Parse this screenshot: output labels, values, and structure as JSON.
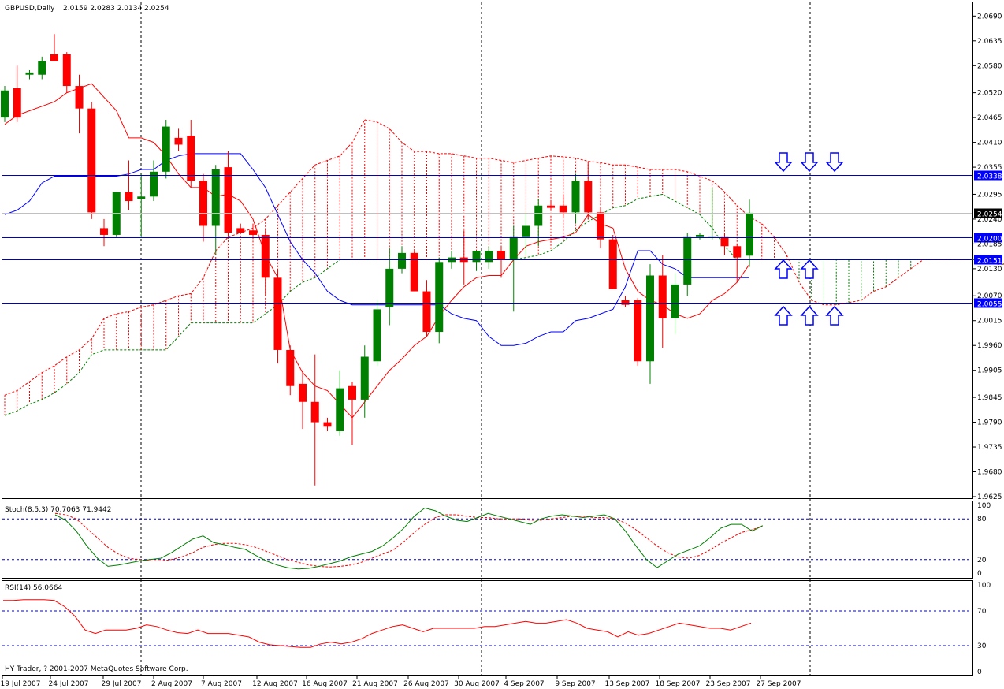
{
  "header": {
    "symbol": "GBPUSD,Daily",
    "ohlc": "2.0159 2.0283 2.0134 2.0254"
  },
  "footer": {
    "copyright": "HY Trader, ? 2001-2007 MetaQuotes Software Corp."
  },
  "colors": {
    "bull": "#008000",
    "bear": "#ff0000",
    "tenkan": "#ff0000",
    "kijun": "#0000ff",
    "span_a": "#ff0000",
    "span_b": "#008000",
    "level_line": "#0000c0",
    "price_tag_bg": "#0000ff",
    "close_tag_bg": "#000000",
    "arrow": "#0000ff"
  },
  "chart_data": [
    {
      "type": "candlestick",
      "title": "GBPUSD,Daily",
      "ylim": [
        1.9625,
        2.0715
      ],
      "y_ticks": [
        "2.0690",
        "2.0635",
        "2.0580",
        "2.0520",
        "2.0465",
        "2.0410",
        "2.0355",
        "2.0295",
        "2.0240",
        "2.0185",
        "2.0130",
        "2.0070",
        "2.0015",
        "1.9960",
        "1.9905",
        "1.9845",
        "1.9790",
        "1.9735",
        "1.9680",
        "1.9625"
      ],
      "x_tick_labels": [
        "19 Jul 2007",
        "24 Jul 2007",
        "29 Jul 2007",
        "2 Aug 2007",
        "7 Aug 2007",
        "12 Aug 2007",
        "16 Aug 2007",
        "21 Aug 2007",
        "26 Aug 2007",
        "30 Aug 2007",
        "4 Sep 2007",
        "9 Sep 2007",
        "13 Sep 2007",
        "18 Sep 2007",
        "23 Sep 2007",
        "27 Sep 2007"
      ],
      "candles": [
        {
          "o": 2.0465,
          "h": 2.0535,
          "l": 2.0455,
          "c": 2.0525
        },
        {
          "o": 2.053,
          "h": 2.058,
          "l": 2.0455,
          "c": 2.0465
        },
        {
          "o": 2.056,
          "h": 2.057,
          "l": 2.055,
          "c": 2.0565
        },
        {
          "o": 2.056,
          "h": 2.06,
          "l": 2.055,
          "c": 2.059
        },
        {
          "o": 2.0605,
          "h": 2.065,
          "l": 2.059,
          "c": 2.059
        },
        {
          "o": 2.0605,
          "h": 2.061,
          "l": 2.052,
          "c": 2.0535
        },
        {
          "o": 2.0535,
          "h": 2.056,
          "l": 2.043,
          "c": 2.0485
        },
        {
          "o": 2.0485,
          "h": 2.05,
          "l": 2.024,
          "c": 2.0255
        },
        {
          "o": 2.022,
          "h": 2.024,
          "l": 2.018,
          "c": 2.0205
        },
        {
          "o": 2.0205,
          "h": 2.03,
          "l": 2.02,
          "c": 2.03
        },
        {
          "o": 2.03,
          "h": 2.037,
          "l": 2.026,
          "c": 2.028
        },
        {
          "o": 2.0285,
          "h": 2.034,
          "l": 2.02,
          "c": 2.029
        },
        {
          "o": 2.029,
          "h": 2.037,
          "l": 2.028,
          "c": 2.0345
        },
        {
          "o": 2.0345,
          "h": 2.046,
          "l": 2.033,
          "c": 2.0445
        },
        {
          "o": 2.042,
          "h": 2.044,
          "l": 2.039,
          "c": 2.0405
        },
        {
          "o": 2.0425,
          "h": 2.046,
          "l": 2.031,
          "c": 2.0325
        },
        {
          "o": 2.0325,
          "h": 2.034,
          "l": 2.019,
          "c": 2.0225
        },
        {
          "o": 2.0225,
          "h": 2.036,
          "l": 2.016,
          "c": 2.035
        },
        {
          "o": 2.0355,
          "h": 2.039,
          "l": 2.02,
          "c": 2.021
        },
        {
          "o": 2.022,
          "h": 2.023,
          "l": 2.021,
          "c": 2.021
        },
        {
          "o": 2.0215,
          "h": 2.023,
          "l": 2.02,
          "c": 2.0205
        },
        {
          "o": 2.0205,
          "h": 2.022,
          "l": 2.007,
          "c": 2.011
        },
        {
          "o": 2.011,
          "h": 2.013,
          "l": 1.992,
          "c": 1.995
        },
        {
          "o": 1.995,
          "h": 1.996,
          "l": 1.985,
          "c": 1.987
        },
        {
          "o": 1.9875,
          "h": 1.9905,
          "l": 1.9775,
          "c": 1.9835
        },
        {
          "o": 1.9835,
          "h": 1.994,
          "l": 1.965,
          "c": 1.979
        },
        {
          "o": 1.979,
          "h": 1.98,
          "l": 1.977,
          "c": 1.978
        },
        {
          "o": 1.977,
          "h": 1.9905,
          "l": 1.976,
          "c": 1.9865
        },
        {
          "o": 1.987,
          "h": 1.988,
          "l": 1.974,
          "c": 1.984
        },
        {
          "o": 1.984,
          "h": 1.996,
          "l": 1.98,
          "c": 1.9935
        },
        {
          "o": 1.9925,
          "h": 2.006,
          "l": 1.9915,
          "c": 2.004
        },
        {
          "o": 2.0045,
          "h": 2.0175,
          "l": 2.0005,
          "c": 2.013
        },
        {
          "o": 2.013,
          "h": 2.018,
          "l": 2.012,
          "c": 2.0165
        },
        {
          "o": 2.0165,
          "h": 2.017,
          "l": 2.008,
          "c": 2.008
        },
        {
          "o": 2.008,
          "h": 2.0105,
          "l": 1.998,
          "c": 1.999
        },
        {
          "o": 1.999,
          "h": 2.0155,
          "l": 1.9965,
          "c": 2.0145
        },
        {
          "o": 2.0145,
          "h": 2.017,
          "l": 2.013,
          "c": 2.0155
        },
        {
          "o": 2.0155,
          "h": 2.0215,
          "l": 2.0095,
          "c": 2.0145
        },
        {
          "o": 2.0145,
          "h": 2.0165,
          "l": 2.0125,
          "c": 2.017
        },
        {
          "o": 2.0145,
          "h": 2.018,
          "l": 2.013,
          "c": 2.017
        },
        {
          "o": 2.017,
          "h": 2.018,
          "l": 2.011,
          "c": 2.015
        },
        {
          "o": 2.015,
          "h": 2.0225,
          "l": 2.0035,
          "c": 2.02
        },
        {
          "o": 2.02,
          "h": 2.0255,
          "l": 2.016,
          "c": 2.0225
        },
        {
          "o": 2.0225,
          "h": 2.0285,
          "l": 2.018,
          "c": 2.027
        },
        {
          "o": 2.027,
          "h": 2.028,
          "l": 2.026,
          "c": 2.0265
        },
        {
          "o": 2.027,
          "h": 2.0295,
          "l": 2.0245,
          "c": 2.0255
        },
        {
          "o": 2.0255,
          "h": 2.034,
          "l": 2.023,
          "c": 2.0325
        },
        {
          "o": 2.0325,
          "h": 2.0365,
          "l": 2.024,
          "c": 2.0255
        },
        {
          "o": 2.0255,
          "h": 2.0265,
          "l": 2.0175,
          "c": 2.0195
        },
        {
          "o": 2.0195,
          "h": 2.0205,
          "l": 2.009,
          "c": 2.0085
        },
        {
          "o": 2.006,
          "h": 2.007,
          "l": 2.0045,
          "c": 2.005
        },
        {
          "o": 2.006,
          "h": 2.0065,
          "l": 1.9915,
          "c": 1.9925
        },
        {
          "o": 1.9925,
          "h": 2.014,
          "l": 1.9875,
          "c": 2.0115
        },
        {
          "o": 2.0115,
          "h": 2.016,
          "l": 1.9955,
          "c": 2.002
        },
        {
          "o": 2.002,
          "h": 2.012,
          "l": 1.9985,
          "c": 2.0095
        },
        {
          "o": 2.0095,
          "h": 2.021,
          "l": 2.007,
          "c": 2.02
        },
        {
          "o": 2.02,
          "h": 2.021,
          "l": 2.0195,
          "c": 2.0205
        },
        {
          "o": 2.02,
          "h": 2.031,
          "l": 2.0195,
          "c": 2.02
        },
        {
          "o": 2.02,
          "h": 2.021,
          "l": 2.016,
          "c": 2.018
        },
        {
          "o": 2.018,
          "h": 2.0185,
          "l": 2.01,
          "c": 2.0155
        },
        {
          "o": 2.0159,
          "h": 2.0283,
          "l": 2.0134,
          "c": 2.0254
        }
      ],
      "ichimoku": {
        "tenkan": [
          2.045,
          2.047,
          2.048,
          2.049,
          2.05,
          2.052,
          2.053,
          2.054,
          2.051,
          2.048,
          2.042,
          2.042,
          2.041,
          2.038,
          2.034,
          2.031,
          2.031,
          2.029,
          2.0295,
          2.028,
          2.024,
          2.016,
          2.011,
          1.995,
          1.99,
          1.987,
          1.986,
          1.983,
          1.98,
          1.9835,
          1.987,
          1.9905,
          1.993,
          1.996,
          1.998,
          2.0025,
          2.006,
          2.009,
          2.011,
          2.0115,
          2.0115,
          2.015,
          2.018,
          2.019,
          2.0195,
          2.02,
          2.021,
          2.025,
          2.023,
          2.022,
          2.013,
          2.008,
          2.006,
          2.005,
          2.003,
          2.002,
          2.003,
          2.006,
          2.0075,
          2.01,
          2.014
        ],
        "kijun": [
          2.025,
          2.026,
          2.028,
          2.032,
          2.0335,
          2.0335,
          2.0335,
          2.0335,
          2.0335,
          2.0335,
          2.034,
          2.035,
          2.035,
          2.037,
          2.038,
          2.0385,
          2.0385,
          2.0385,
          2.0385,
          2.0385,
          2.035,
          2.031,
          2.025,
          2.019,
          2.015,
          2.012,
          2.008,
          2.006,
          2.005,
          2.005,
          2.005,
          2.005,
          2.005,
          2.005,
          2.005,
          2.005,
          2.003,
          2.002,
          2.0015,
          1.998,
          1.996,
          1.996,
          1.9965,
          1.998,
          1.999,
          1.999,
          2.0015,
          2.002,
          2.003,
          2.004,
          2.009,
          2.017,
          2.017,
          2.014,
          2.013,
          2.011,
          2.011,
          2.011,
          2.011,
          2.011,
          2.011
        ],
        "kijun_start_index": 0,
        "span_a": [
          1.985,
          1.986,
          1.988,
          1.99,
          1.9915,
          1.9935,
          1.995,
          1.9975,
          2.002,
          2.003,
          2.0035,
          2.0045,
          2.005,
          2.006,
          2.007,
          2.0075,
          2.011,
          2.017,
          2.02,
          2.021,
          2.022,
          2.024,
          2.027,
          2.03,
          2.033,
          2.036,
          2.037,
          2.038,
          2.041,
          2.046,
          2.0455,
          2.044,
          2.041,
          2.039,
          2.039,
          2.0385,
          2.0385,
          2.038,
          2.0375,
          2.0375,
          2.037,
          2.0365,
          2.037,
          2.0375,
          2.038,
          2.0378,
          2.0375,
          2.0368,
          2.0365,
          2.036,
          2.036,
          2.0355,
          2.035,
          2.035,
          2.035,
          2.0345,
          2.0335,
          2.0325,
          2.03,
          2.027,
          2.0245,
          2.023,
          2.02,
          2.016,
          2.01,
          2.006,
          2.005,
          2.005,
          2.0055,
          2.006,
          2.008,
          2.009,
          2.011,
          2.013,
          2.015,
          2.015,
          2.015,
          2.015,
          2.015,
          2.015,
          2.014,
          2.014,
          2.0145,
          2.0145,
          2.0145,
          2.013,
          2.011,
          2.01,
          2.01,
          2.0095,
          2.0075
        ],
        "span_b": [
          1.9805,
          1.9815,
          1.983,
          1.984,
          1.9855,
          1.9875,
          1.99,
          1.994,
          1.995,
          1.995,
          1.995,
          1.995,
          1.995,
          1.995,
          1.998,
          2.001,
          2.001,
          2.001,
          2.001,
          2.001,
          2.001,
          2.003,
          2.005,
          2.008,
          2.01,
          2.011,
          2.013,
          2.015,
          2.015,
          2.015,
          2.015,
          2.015,
          2.015,
          2.015,
          2.015,
          2.015,
          2.015,
          2.015,
          2.015,
          2.015,
          2.015,
          2.015,
          2.0155,
          2.016,
          2.017,
          2.019,
          2.0215,
          2.0235,
          2.025,
          2.0265,
          2.027,
          2.0285,
          2.029,
          2.0295,
          2.028,
          2.0265,
          2.025,
          2.022,
          2.018,
          2.015,
          2.015,
          2.015,
          2.015,
          2.015,
          2.015,
          2.015,
          2.015,
          2.015,
          2.015,
          2.015,
          2.015,
          2.015,
          2.015,
          2.015,
          2.015,
          2.015,
          2.015,
          2.015,
          2.015,
          2.015,
          2.015,
          2.013,
          2.01,
          2.009,
          2.0085,
          2.0085,
          2.0075,
          2.0065,
          2.006,
          2.0055,
          2.0055
        ]
      },
      "levels": [
        {
          "value": 2.0338,
          "label": "2.0338"
        },
        {
          "value": 2.0254,
          "label": "2.0254",
          "close": true
        },
        {
          "value": 2.02,
          "label": "2.0200"
        },
        {
          "value": 2.0151,
          "label": "2.0151"
        },
        {
          "value": 2.0055,
          "label": "2.0055"
        }
      ]
    },
    {
      "type": "line",
      "title": "Stoch(8,5,3) 70.7063 71.9442",
      "ylim": [
        0,
        100
      ],
      "y_ticks": [
        "100",
        "80",
        "20",
        "0"
      ],
      "levels": [
        80,
        20
      ],
      "main": [
        86,
        78,
        62,
        40,
        22,
        10,
        12,
        15,
        18,
        20,
        22,
        30,
        40,
        50,
        55,
        45,
        42,
        38,
        35,
        26,
        18,
        12,
        8,
        6,
        7,
        10,
        14,
        18,
        24,
        28,
        32,
        40,
        52,
        66,
        84,
        96,
        92,
        84,
        78,
        76,
        82,
        88,
        84,
        80,
        76,
        72,
        80,
        84,
        86,
        84,
        82,
        84,
        86,
        80,
        62,
        40,
        20,
        8,
        18,
        28,
        34,
        40,
        52,
        66,
        72,
        72,
        62,
        70
      ],
      "signal": [
        88,
        86,
        80,
        66,
        52,
        38,
        28,
        22,
        20,
        18,
        18,
        20,
        24,
        30,
        38,
        42,
        44,
        44,
        42,
        38,
        32,
        26,
        20,
        16,
        12,
        10,
        9,
        10,
        12,
        16,
        22,
        28,
        34,
        46,
        60,
        72,
        82,
        86,
        86,
        84,
        82,
        82,
        80,
        80,
        80,
        78,
        78,
        80,
        82,
        84,
        84,
        82,
        82,
        80,
        74,
        64,
        52,
        40,
        30,
        24,
        22,
        26,
        34,
        44,
        52,
        60,
        64,
        70
      ],
      "trail_labels": []
    },
    {
      "type": "line",
      "title": "RSI(14) 56.0664",
      "ylim": [
        0,
        100
      ],
      "y_ticks": [
        "100",
        "70",
        "30",
        "0"
      ],
      "levels": [
        70,
        30
      ],
      "values": [
        82,
        82,
        83,
        83,
        83,
        82,
        75,
        64,
        48,
        44,
        48,
        48,
        48,
        50,
        54,
        52,
        48,
        45,
        44,
        48,
        44,
        44,
        44,
        42,
        40,
        34,
        31,
        30,
        29,
        28,
        28,
        32,
        34,
        32,
        34,
        38,
        44,
        48,
        52,
        54,
        50,
        46,
        50,
        50,
        50,
        50,
        50,
        52,
        52,
        54,
        56,
        58,
        56,
        56,
        58,
        60,
        56,
        50,
        48,
        46,
        40,
        46,
        42,
        44,
        48,
        52,
        56,
        54,
        52,
        50,
        50,
        48,
        52,
        56
      ]
    }
  ]
}
